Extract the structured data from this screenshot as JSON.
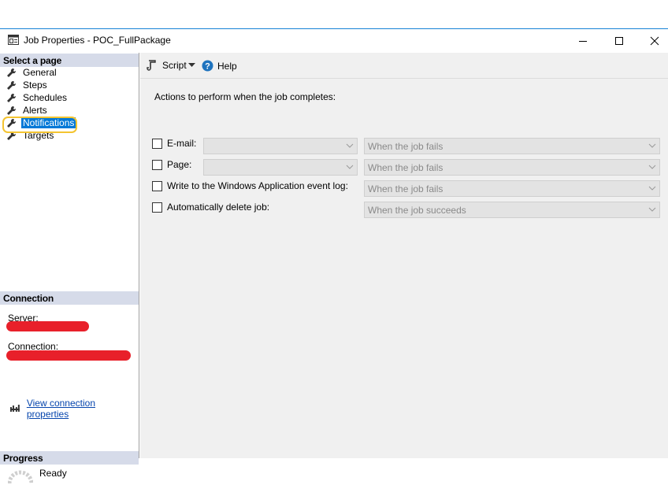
{
  "window": {
    "title": "Job Properties - POC_FullPackage"
  },
  "left_pane": {
    "select_header": "Select a page",
    "pages": [
      {
        "label": "General",
        "selected": false
      },
      {
        "label": "Steps",
        "selected": false
      },
      {
        "label": "Schedules",
        "selected": false
      },
      {
        "label": "Alerts",
        "selected": false
      },
      {
        "label": "Notifications",
        "selected": true
      },
      {
        "label": "Targets",
        "selected": false
      }
    ],
    "connection_header": "Connection",
    "server_label": "Server:",
    "connection_label": "Connection:",
    "view_connection_link": "View connection properties",
    "progress_header": "Progress",
    "progress_status": "Ready"
  },
  "toolbar": {
    "script_label": "Script",
    "help_label": "Help"
  },
  "notifications": {
    "caption": "Actions to perform when the job completes:",
    "email": {
      "label": "E-mail:",
      "operator_value": "",
      "condition_value": "When the job fails",
      "checked": false
    },
    "page": {
      "label": "Page:",
      "operator_value": "",
      "condition_value": "When the job fails",
      "checked": false
    },
    "eventlog": {
      "label": "Write to the Windows Application event log:",
      "condition_value": "When the job fails",
      "checked": false
    },
    "delete": {
      "label": "Automatically delete job:",
      "condition_value": "When the job succeeds",
      "checked": false
    }
  },
  "colors": {
    "selection": "#0078d7",
    "section_header": "#d6dbe9",
    "highlight_ring": "#f4c430",
    "redaction": "#e8202a",
    "link": "#0645ad"
  }
}
